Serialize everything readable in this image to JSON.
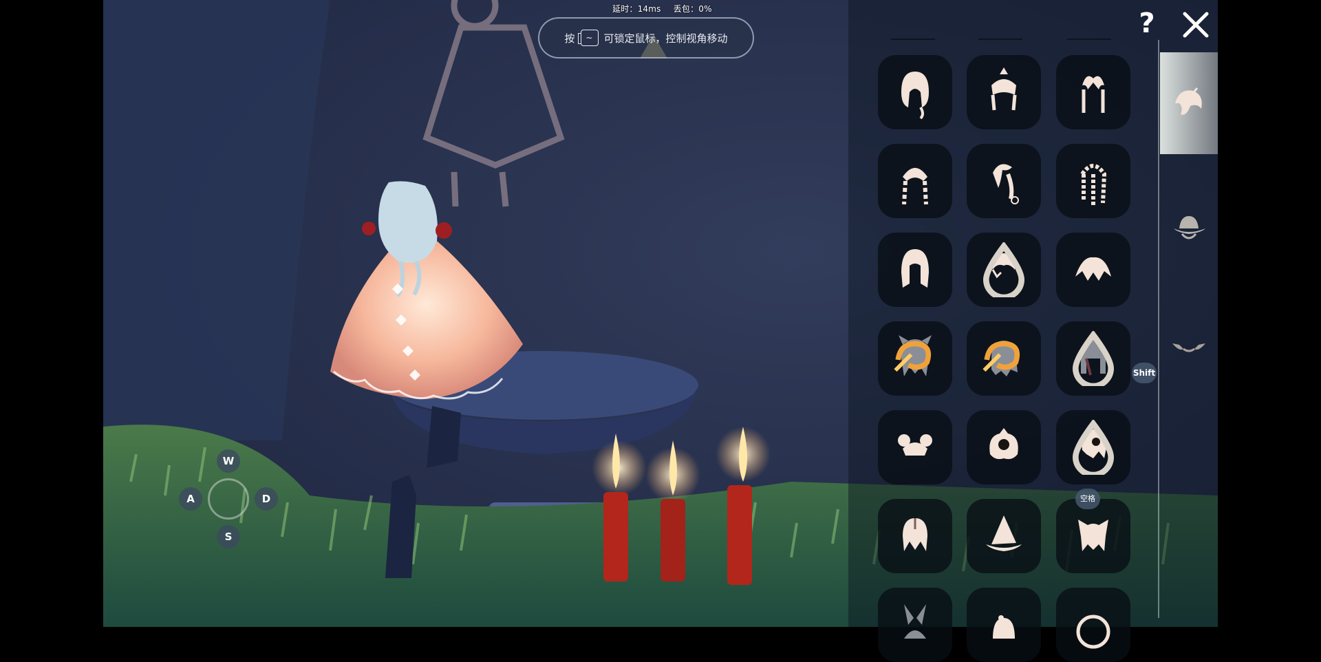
{
  "stats": {
    "latency": "延时：14ms",
    "packet_loss": "丢包：0%"
  },
  "hint": {
    "prefix": "按",
    "key": "~",
    "text": "可锁定鼠标，控制视角移动"
  },
  "joystick": {
    "up": "W",
    "left": "A",
    "right": "D",
    "down": "S"
  },
  "panel": {
    "shift_label": "Shift",
    "space_label": "空格",
    "categories": [
      {
        "name": "hair-category-icon",
        "active": true
      },
      {
        "name": "hat-category-icon",
        "active": false
      },
      {
        "name": "horn-category-icon",
        "active": false
      }
    ],
    "items": [
      {
        "icon": "hair-style-1-icon"
      },
      {
        "icon": "hair-style-2-icon"
      },
      {
        "icon": "hair-style-3-icon"
      },
      {
        "icon": "hair-style-4-icon"
      },
      {
        "icon": "hair-style-5-icon"
      },
      {
        "icon": "hair-style-6-icon"
      },
      {
        "icon": "hair-style-7-icon"
      },
      {
        "icon": "hair-style-8-icon"
      },
      {
        "icon": "hair-style-9-icon"
      },
      {
        "icon": "hair-style-10-icon"
      },
      {
        "icon": "hair-style-11-icon"
      },
      {
        "icon": "hair-style-12-icon"
      },
      {
        "icon": "hair-style-13-icon"
      },
      {
        "icon": "hair-style-14-icon"
      },
      {
        "icon": "hair-style-15-icon"
      },
      {
        "icon": "hair-style-16-icon"
      },
      {
        "icon": "hair-style-17-icon"
      },
      {
        "icon": "hair-style-18-icon"
      },
      {
        "icon": "hair-style-19-icon"
      },
      {
        "icon": "hair-style-20-icon"
      },
      {
        "icon": "hair-style-21-icon"
      }
    ]
  },
  "colors": {
    "icon": "#f3e3d8",
    "locked": "#8a8e96",
    "candle": "#b2261c",
    "flame": "#ffe7a8",
    "cape": "#f7c3a6"
  }
}
